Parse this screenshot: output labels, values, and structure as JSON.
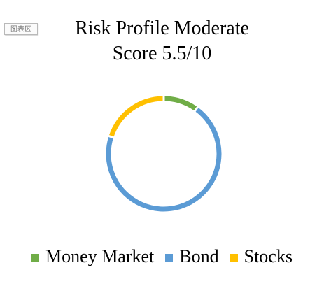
{
  "badge": "图表区",
  "chart_data": {
    "type": "pie",
    "style": "doughnut",
    "title_lines": [
      "Risk Profile Moderate",
      "Score 5.5/10"
    ],
    "categories": [
      "Money Market",
      "Bond",
      "Stocks"
    ],
    "values": [
      10,
      70,
      20
    ],
    "colors": [
      "#70ad47",
      "#5b9bd5",
      "#ffc000"
    ],
    "legend_position": "bottom",
    "start_angle_deg": 0,
    "direction": "clockwise"
  }
}
